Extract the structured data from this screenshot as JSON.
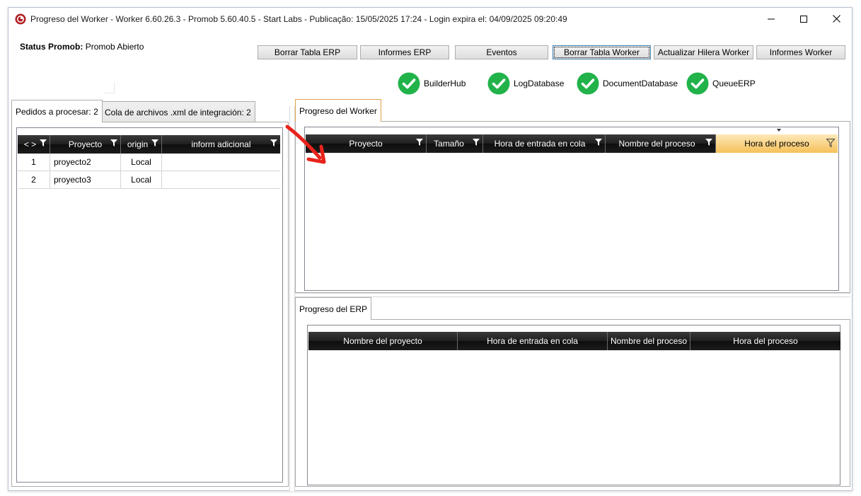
{
  "window": {
    "title": "Progreso del Worker  -  Worker 6.60.26.3 - Promob 5.60.40.5  -  Start Labs  -  Publicação: 15/05/2025 17:24 - Login expira el: 04/09/2025 09:20:49",
    "icon": "promob-logo-icon",
    "controls": [
      "minimize-icon",
      "maximize-icon",
      "close-icon"
    ]
  },
  "status": {
    "label": "Status Promob:",
    "value": "Promob Abierto"
  },
  "toolbar": {
    "borrar_tabla_erp": "Borrar Tabla ERP",
    "informes_erp": "Informes ERP",
    "eventos": "Eventos",
    "borrar_tabla_worker": "Borrar Tabla Worker",
    "actualizar_hilera_worker": "Actualizar Hilera Worker",
    "informes_worker": "Informes Worker"
  },
  "services": [
    {
      "name": "BuilderHub",
      "status": "ok",
      "color": "#21b34a"
    },
    {
      "name": "LogDatabase",
      "status": "ok",
      "color": "#21b34a"
    },
    {
      "name": "DocumentDatabase",
      "status": "ok",
      "color": "#21b34a"
    },
    {
      "name": "QueueERP",
      "status": "ok",
      "color": "#21b34a"
    }
  ],
  "left_panel": {
    "tabs": [
      "Pedidos a procesar: 2",
      "Cola de archivos .xml de integración: 2"
    ],
    "active_tab": 0,
    "columns": [
      "< >",
      "Proyecto",
      "origin",
      "inform adicional"
    ],
    "rows": [
      {
        "n": "1",
        "proyecto": "proyecto2",
        "origin": "Local",
        "info": ""
      },
      {
        "n": "2",
        "proyecto": "proyecto3",
        "origin": "Local",
        "info": ""
      }
    ]
  },
  "worker_panel": {
    "tab": "Progreso del Worker",
    "columns": [
      "Proyecto",
      "Tamaño",
      "Hora de entrada en cola",
      "Nombre del proceso",
      "Hora del proceso"
    ],
    "highlighted_column": "Hora del proceso",
    "accent_color": "#f6c15a",
    "rows": []
  },
  "erp_panel": {
    "tab": "Progreso del ERP",
    "columns": [
      "Nombre del proyecto",
      "Hora de entrada en cola",
      "Nombre del proceso",
      "Hora del proceso"
    ],
    "rows": []
  },
  "annotation": {
    "icon": "red-arrow-icon",
    "color": "#e8231b"
  }
}
